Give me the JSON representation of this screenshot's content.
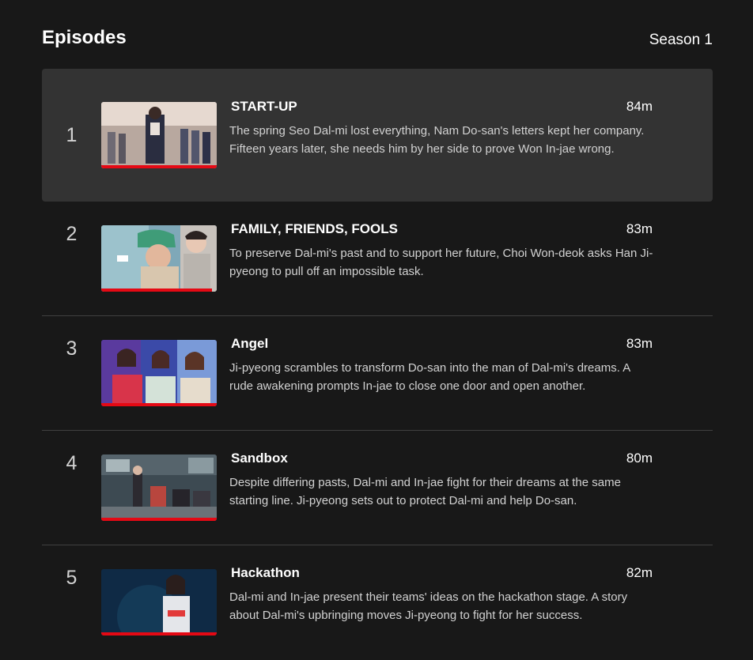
{
  "header": {
    "title": "Episodes",
    "season": "Season 1"
  },
  "episodes": [
    {
      "number": "1",
      "title": "START-UP",
      "duration": "84m",
      "description": "The spring Seo Dal-mi lost everything, Nam Do-san's letters kept her company. Fifteen years later, she needs him by her side to prove Won In-jae wrong.",
      "progress": 1.0
    },
    {
      "number": "2",
      "title": "FAMILY, FRIENDS, FOOLS",
      "duration": "83m",
      "description": "To preserve Dal-mi's past and to support her future, Choi Won-deok asks Han Ji-pyeong to pull off an impossible task.",
      "progress": 0.96
    },
    {
      "number": "3",
      "title": "Angel",
      "duration": "83m",
      "description": "Ji-pyeong scrambles to transform Do-san into the man of Dal-mi's dreams. A rude awakening prompts In-jae to close one door and open another.",
      "progress": 1.0
    },
    {
      "number": "4",
      "title": "Sandbox",
      "duration": "80m",
      "description": "Despite differing pasts, Dal-mi and In-jae fight for their dreams at the same starting line. Ji-pyeong sets out to protect Dal-mi and help Do-san.",
      "progress": 1.0
    },
    {
      "number": "5",
      "title": "Hackathon",
      "duration": "82m",
      "description": "Dal-mi and In-jae present their teams' ideas on the hackathon stage. A story about Dal-mi's upbringing moves Ji-pyeong to fight for her success.",
      "progress": 1.0
    }
  ]
}
